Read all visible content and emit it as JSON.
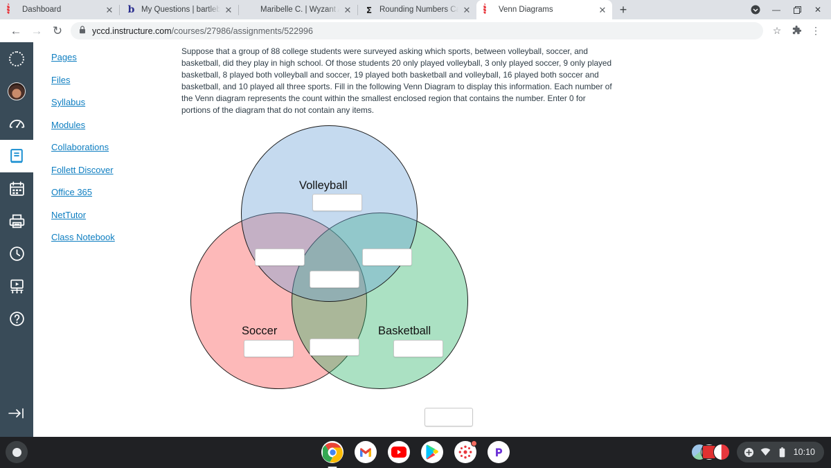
{
  "browser": {
    "tabs": [
      {
        "title": "Dashboard",
        "favicon": "canvas-ring-icon",
        "active": false
      },
      {
        "title": "My Questions | bartleby",
        "favicon": "bartleby-b-icon",
        "active": false
      },
      {
        "title": "Maribelle C. | Wyzant Ask An E",
        "favicon": "wyzant-icon",
        "active": false
      },
      {
        "title": "Rounding Numbers Calculator",
        "favicon": "sigma-icon",
        "active": false
      },
      {
        "title": "Venn Diagrams",
        "favicon": "canvas-ring-icon",
        "active": true
      }
    ],
    "new_tab_label": "+",
    "close_label": "✕",
    "window_controls": {
      "profile": "●",
      "minimize": "—",
      "maximize": "❐",
      "close": "✕"
    },
    "toolbar": {
      "back_label": "←",
      "forward_label": "→",
      "reload_label": "↻",
      "lock_label": "🔒",
      "url_host": "yccd.instructure.com",
      "url_path": "/courses/27986/assignments/522996",
      "bookmark_label": "☆",
      "extensions_label": "🧩",
      "menu_label": "⋮"
    }
  },
  "global_nav": {
    "items": [
      {
        "name": "canvas-logo",
        "label": "Canvas"
      },
      {
        "name": "account-avatar",
        "label": "Account"
      },
      {
        "name": "dashboard-icon",
        "label": "Dashboard"
      },
      {
        "name": "courses-icon",
        "label": "Courses"
      },
      {
        "name": "calendar-icon",
        "label": "Calendar"
      },
      {
        "name": "inbox-icon",
        "label": "Inbox"
      },
      {
        "name": "history-icon",
        "label": "History"
      },
      {
        "name": "studio-icon",
        "label": "Studio"
      },
      {
        "name": "help-icon",
        "label": "Help"
      }
    ],
    "collapse_label": "→|"
  },
  "course_nav": {
    "items": [
      {
        "label": "Pages"
      },
      {
        "label": "Files"
      },
      {
        "label": "Syllabus"
      },
      {
        "label": "Modules"
      },
      {
        "label": "Collaborations"
      },
      {
        "label": "Follett Discover"
      },
      {
        "label": "Office 365"
      },
      {
        "label": "NetTutor"
      },
      {
        "label": "Class Notebook"
      }
    ]
  },
  "question": {
    "text": "Suppose that a group of 88 college students were surveyed asking which sports, between volleyball, soccer, and basketball, did they play in high school. Of those students 20 only played volleyball, 3 only played soccer, 9 only played basketball, 8 played both volleyball and soccer, 19 played both basketball and volleyball, 16 played both soccer and basketball, and 10 played all three sports. Fill in the following Venn Diagram to display this information.  Each number of the Venn diagram represents the count within the smallest enclosed region that contains the number.  Enter 0 for portions of the diagram that do not contain any items."
  },
  "venn": {
    "sets": [
      {
        "key": "volleyball",
        "label": "Volleyball",
        "color": "#6ea3d6"
      },
      {
        "key": "soccer",
        "label": "Soccer",
        "color": "#f95050"
      },
      {
        "key": "basketball",
        "label": "Basketball",
        "color": "#2cb46a"
      }
    ],
    "inputs": [
      {
        "name": "volleyball-only-input",
        "value": "",
        "placeholder": ""
      },
      {
        "name": "soccer-only-input",
        "value": "",
        "placeholder": ""
      },
      {
        "name": "basketball-only-input",
        "value": "",
        "placeholder": ""
      },
      {
        "name": "volleyball-soccer-input",
        "value": "",
        "placeholder": ""
      },
      {
        "name": "volleyball-basketball-input",
        "value": "",
        "placeholder": ""
      },
      {
        "name": "all-three-input",
        "value": "",
        "placeholder": ""
      },
      {
        "name": "soccer-basketball-input",
        "value": "",
        "placeholder": ""
      },
      {
        "name": "outside-all-input",
        "value": "",
        "placeholder": ""
      }
    ]
  },
  "shelf": {
    "launcher_label": "Launcher",
    "apps": [
      {
        "name": "chrome-icon",
        "label": "Chrome",
        "active": true,
        "badge": false
      },
      {
        "name": "gmail-icon",
        "label": "Gmail",
        "active": false,
        "badge": false
      },
      {
        "name": "youtube-icon",
        "label": "YouTube",
        "active": false,
        "badge": false
      },
      {
        "name": "play-store-icon",
        "label": "Play Store",
        "active": false,
        "badge": false
      },
      {
        "name": "canvas-student-icon",
        "label": "Canvas Student",
        "active": false,
        "badge": true
      },
      {
        "name": "pearson-icon",
        "label": "Pearson",
        "active": false,
        "badge": false
      }
    ],
    "tray": {
      "cast_label": "⊕",
      "wifi_label": "wifi-icon",
      "battery_label": "battery-icon",
      "time": "10:10"
    }
  }
}
